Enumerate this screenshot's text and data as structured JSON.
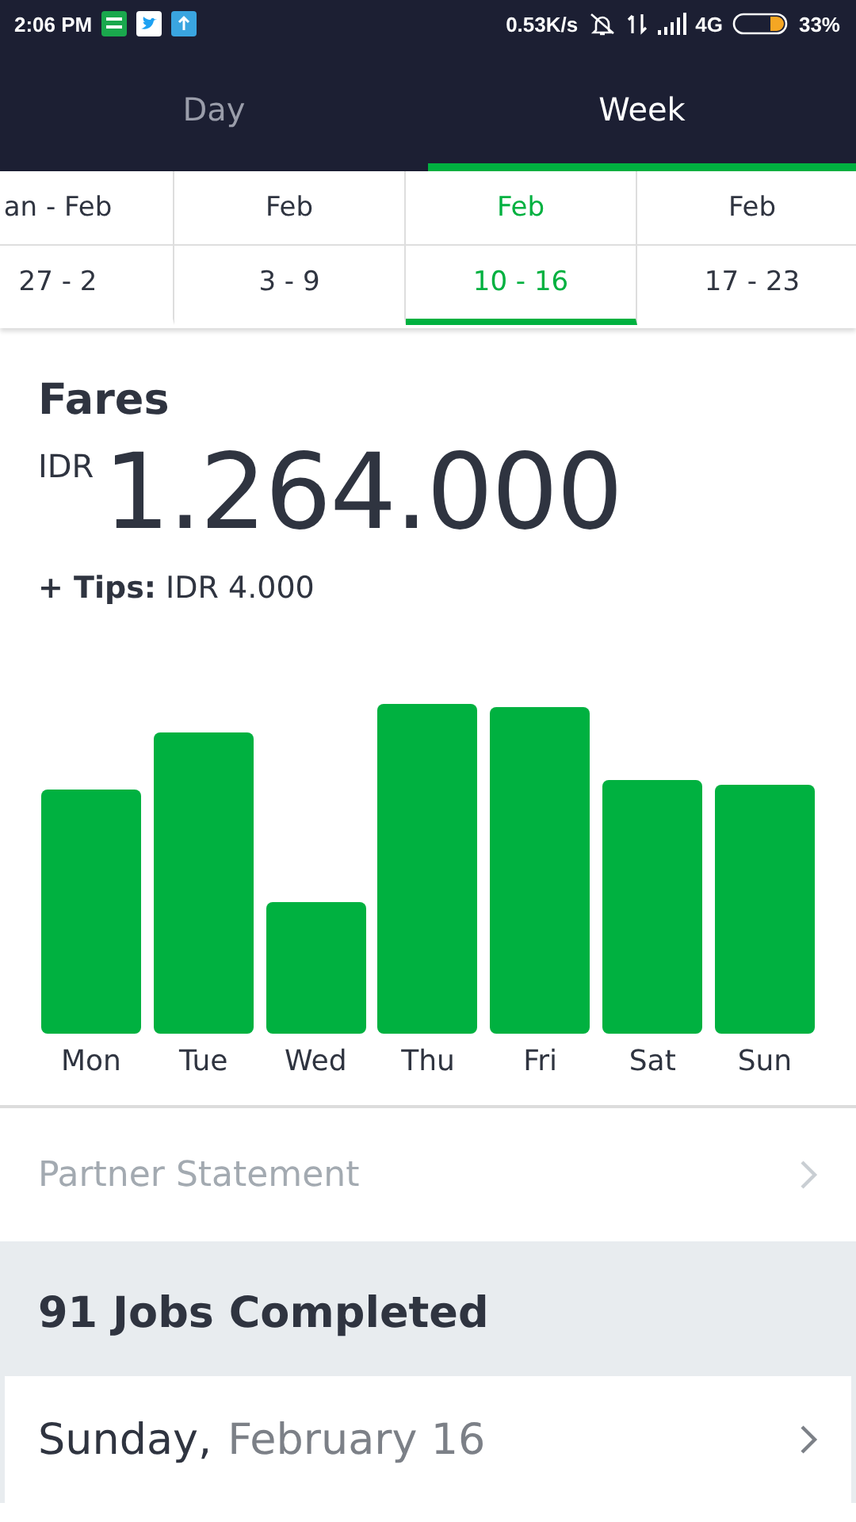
{
  "status_bar": {
    "time": "2:06 PM",
    "speed": "0.53K/s",
    "network": "4G",
    "battery": "33%"
  },
  "tabs": [
    {
      "label": "Day",
      "selected": false
    },
    {
      "label": "Week",
      "selected": true
    }
  ],
  "weeks": [
    {
      "month": "an - Feb",
      "days": "27 - 2",
      "selected": false
    },
    {
      "month": "Feb",
      "days": "3 - 9",
      "selected": false
    },
    {
      "month": "Feb",
      "days": "10 - 16",
      "selected": true
    },
    {
      "month": "Feb",
      "days": "17 - 23",
      "selected": false
    }
  ],
  "fares": {
    "title": "Fares",
    "currency": "IDR",
    "amount": "1.264.000",
    "tips_label": "+ Tips:",
    "tips_value": "IDR 4.000"
  },
  "chart_days": [
    "Mon",
    "Tue",
    "Wed",
    "Thu",
    "Fri",
    "Sat",
    "Sun"
  ],
  "partner_statement": {
    "label": "Partner Statement",
    "disabled": true
  },
  "jobs_header": "91 Jobs Completed",
  "day_rows": [
    {
      "weekday": "Sunday,",
      "date": "February 16"
    }
  ]
}
